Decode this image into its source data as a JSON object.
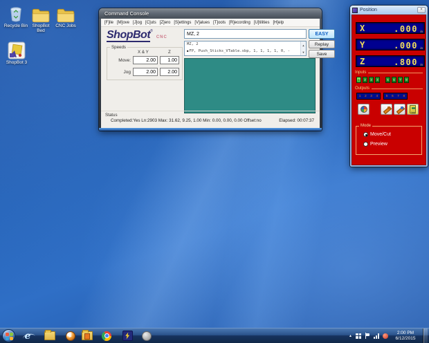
{
  "desktop": {
    "icons": [
      {
        "label": "Recycle Bin"
      },
      {
        "label": "ShopBot Bed"
      },
      {
        "label": "CNC Jobs"
      },
      {
        "label": "ShopBot 3"
      }
    ]
  },
  "command_console": {
    "title": "Command Console",
    "menu": [
      "[F]ile",
      "[M]ove",
      "[J]og",
      "[C]uts",
      "[Z]ero",
      "[S]ettings",
      "[V]alues",
      "[T]ools",
      "[R]ecording",
      "[U]tilities",
      "[H]elp"
    ],
    "logo": {
      "brand": "ShopBot",
      "reg": "®",
      "sub": "CNC"
    },
    "command_input": {
      "value": "MZ, 2"
    },
    "easy_button": "EASY",
    "history": {
      "bullet": "●",
      "line1": "MZ, 2",
      "line2": "FP, Push_Sticks_VTable.sbp,  1,  1,  1,  1,  0,  -"
    },
    "replay_button": "Replay",
    "save_button": "Save",
    "speeds": {
      "label": "Speeds",
      "col_xy": "X & Y",
      "col_z": "Z",
      "move_label": "Move:",
      "jog_label": "Jog",
      "move_xy": "2.00",
      "move_z": "1.00",
      "jog_xy": "2.00",
      "jog_z": "2.00"
    },
    "status": {
      "label": "Status",
      "text": "Completed:Yes Ln:2903 Max: 31.62, 9.25, 1.00  Min: 0.00, 0.00, 0.00  Offset:no",
      "elapsed": "Elapsed: 00:07:37"
    }
  },
  "position_window": {
    "title": "Position",
    "close": "×",
    "axes": [
      {
        "name": "X",
        "value": ".000",
        "unit": "in"
      },
      {
        "name": "Y",
        "value": ".000",
        "unit": "in"
      },
      {
        "name": "Z",
        "value": ".800",
        "unit": "in"
      }
    ],
    "inputs": {
      "label": "Inputs",
      "group1": [
        "1",
        "2",
        "3",
        "4"
      ],
      "group2": [
        "5",
        "6",
        "7",
        "8"
      ],
      "active": "1"
    },
    "outputs": {
      "label": "Outputs",
      "group1": [
        "1",
        "2",
        "3",
        "4"
      ],
      "group2": [
        "5",
        "6",
        "7",
        "8"
      ]
    },
    "mode": {
      "label": "Mode",
      "option1": "Move/Cut",
      "option2": "Preview",
      "selected": "Move/Cut"
    }
  },
  "taskbar": {
    "icons": [
      "internet-explorer",
      "windows-explorer",
      "media-player",
      "documents-folder",
      "chrome",
      "shopbot",
      "partworks"
    ],
    "tray_icons": [
      "tray-expand",
      "tray-grid",
      "action-center-flag",
      "network",
      "shopbot-tray"
    ],
    "clock": {
      "time": "2:00 PM",
      "date": "6/12/2015"
    }
  },
  "colors": {
    "position_body": "#c90000",
    "display_navy": "#000090",
    "digit_yellow": "#f2df5a",
    "console_display_teal": "#2e8b85",
    "easy_text": "#0a5dc2"
  }
}
